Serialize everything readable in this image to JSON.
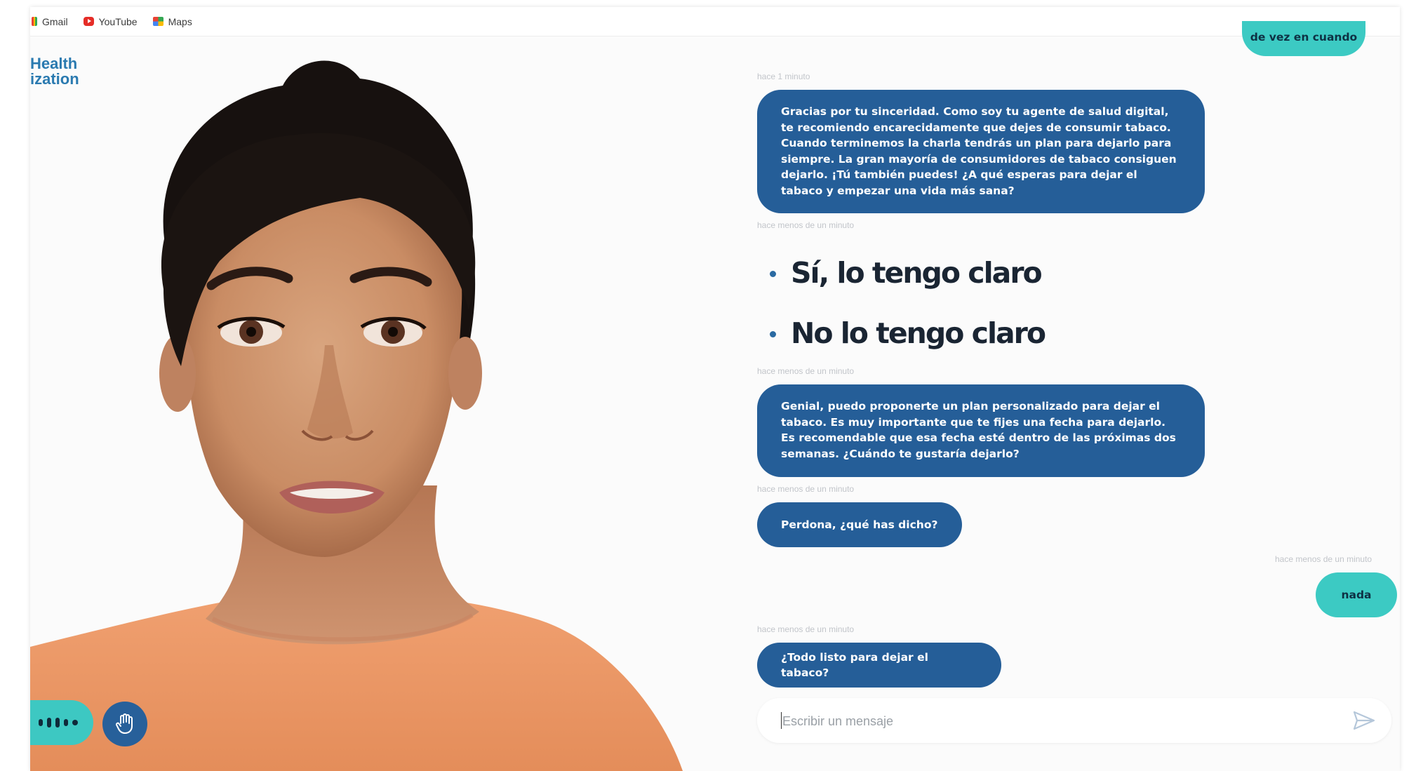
{
  "bookmarks": [
    {
      "label": "Gmail",
      "icon": "gmail-icon"
    },
    {
      "label": "YouTube",
      "icon": "youtube-icon"
    },
    {
      "label": "Maps",
      "icon": "maps-icon"
    }
  ],
  "logo": {
    "line1": "Health",
    "line2": "ization"
  },
  "colors": {
    "agent_bubble": "#255e98",
    "user_bubble": "#3ccac3",
    "accent": "#2a6aa2"
  },
  "chat": {
    "top_user_bubble": "de vez en cuando",
    "messages": [
      {
        "timestamp": "hace 1 minuto",
        "text": "Gracias por tu sinceridad. Como soy tu agente de salud digital, te recomiendo encarecidamente que dejes de consumir tabaco. Cuando terminemos la charla tendrás un plan para dejarlo para siempre. La gran mayoría de consumidores de tabaco consiguen dejarlo. ¡Tú también puedes! ¿A qué esperas para dejar el tabaco y empezar una vida más sana?"
      },
      {
        "timestamp": "hace menos de un minuto"
      },
      {
        "timestamp": "hace menos de un minuto",
        "text": "Genial, puedo proponerte un plan personalizado para dejar el tabaco. Es muy importante que te fijes una fecha para dejarlo. Es recomendable que esa fecha esté dentro de las próximas dos semanas. ¿Cuándo te gustaría dejarlo?"
      },
      {
        "timestamp": "hace menos de un minuto",
        "text": "Perdona, ¿qué has dicho?"
      },
      {
        "timestamp": "hace menos de un minuto",
        "text": "nada"
      },
      {
        "timestamp": "hace menos de un minuto",
        "text": "¿Todo listo para dejar el tabaco?"
      }
    ],
    "options": [
      "Sí, lo tengo claro",
      "No lo tengo claro"
    ]
  },
  "input": {
    "placeholder": "Escribir un mensaje"
  },
  "icons": {
    "mic": "microphone-bars-icon",
    "hand": "raise-hand-icon",
    "send": "send-icon"
  }
}
